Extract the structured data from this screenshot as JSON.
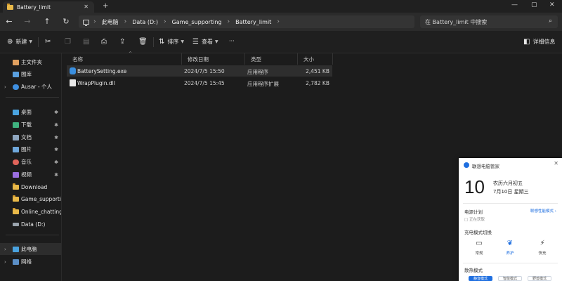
{
  "window": {
    "tab_title": "Battery_limit",
    "tab_close": "✕",
    "new_tab": "+",
    "minimize": "—",
    "maximize": "▢",
    "close": "✕"
  },
  "nav": {
    "back": "←",
    "forward": "→",
    "up": "↑",
    "refresh": "↻"
  },
  "address": {
    "crumbs": [
      "此电脑",
      "Data (D:)",
      "Game_supporting",
      "Battery_limit"
    ],
    "separator": "›",
    "more": "›"
  },
  "search": {
    "placeholder": "在 Battery_limit 中搜索"
  },
  "toolbar": {
    "new_label": "新建",
    "sort_label": "排序",
    "view_label": "查看",
    "more_label": "···",
    "details_label": "详细信息"
  },
  "sidebar": {
    "items": [
      {
        "label": "主文件夹",
        "icon": "home-icon"
      },
      {
        "label": "图库",
        "icon": "gallery-icon"
      },
      {
        "label": "Ausar - 个人",
        "icon": "cloud-icon"
      },
      {
        "label": "桌面",
        "icon": "desktop-icon"
      },
      {
        "label": "下载",
        "icon": "download-icon"
      },
      {
        "label": "文档",
        "icon": "document-icon"
      },
      {
        "label": "图片",
        "icon": "pictures-icon"
      },
      {
        "label": "音乐",
        "icon": "music-icon"
      },
      {
        "label": "视频",
        "icon": "video-icon"
      },
      {
        "label": "Download",
        "icon": "folder-icon"
      },
      {
        "label": "Game_supporting",
        "icon": "folder-icon"
      },
      {
        "label": "Online_chatting",
        "icon": "folder-icon"
      },
      {
        "label": "Data (D:)",
        "icon": "drive-icon"
      },
      {
        "label": "此电脑",
        "icon": "computer-icon"
      },
      {
        "label": "网络",
        "icon": "network-icon"
      }
    ]
  },
  "columns": {
    "name": "名称",
    "modified": "修改日期",
    "type": "类型",
    "size": "大小"
  },
  "files": [
    {
      "name": "BatterySetting.exe",
      "modified": "2024/7/5 15:50",
      "type": "应用程序",
      "size": "2,451 KB",
      "icon": "exe-icon"
    },
    {
      "name": "WrapPlugin.dll",
      "modified": "2024/7/5 15:45",
      "type": "应用程序扩展",
      "size": "2,782 KB",
      "icon": "dll-icon"
    }
  ],
  "panel": {
    "title": "联想电脑管家",
    "close": "✕",
    "day": "10",
    "lunar": "农历六月初五",
    "date": "7月10日 星期三",
    "power_plan_label": "电源计划",
    "power_plan_link": "联想性能模式 ›",
    "power_plan_status": "正在获取",
    "charge_mode_label": "充电模式切换",
    "charge_modes": [
      {
        "label": "常规",
        "icon": "battery-normal-icon",
        "glyph": "▭"
      },
      {
        "label": "养护",
        "icon": "battery-care-icon",
        "glyph": "❦"
      },
      {
        "label": "快充",
        "icon": "battery-fast-icon",
        "glyph": "⚡"
      }
    ],
    "perf_mode_label": "散热模式",
    "perf_modes": [
      "静音模式",
      "智能模式",
      "野兽模式"
    ]
  },
  "colors": {
    "accent": "#1f6fe0",
    "folder": "#e9b949",
    "background": "#1c1c1c"
  }
}
